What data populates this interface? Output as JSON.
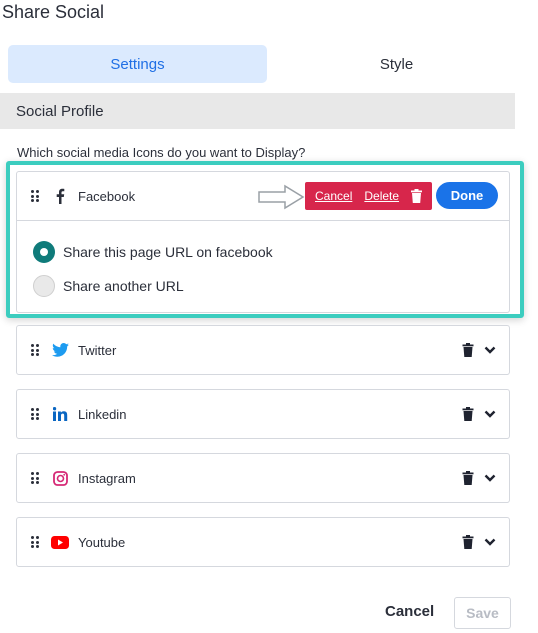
{
  "page": {
    "title": "Share Social"
  },
  "tabs": [
    {
      "label": "Settings",
      "active": true
    },
    {
      "label": "Style",
      "active": false
    }
  ],
  "section": {
    "header": "Social Profile",
    "question": "Which social media Icons do you want to Display?"
  },
  "editing": {
    "network": "Facebook",
    "cancel_label": "Cancel",
    "delete_label": "Delete",
    "done_label": "Done",
    "options": [
      {
        "label": "Share this page URL on facebook",
        "selected": true
      },
      {
        "label": "Share another URL",
        "selected": false
      }
    ]
  },
  "networks": [
    {
      "name": "Twitter",
      "icon": "twitter-icon",
      "color": "#1d9bf0"
    },
    {
      "name": "Linkedin",
      "icon": "linkedin-icon",
      "color": "#0a66c2"
    },
    {
      "name": "Instagram",
      "icon": "instagram-icon",
      "color": "#d62976"
    },
    {
      "name": "Youtube",
      "icon": "youtube-icon",
      "color": "#ff0000"
    }
  ],
  "footer": {
    "cancel_label": "Cancel",
    "save_label": "Save"
  },
  "colors": {
    "accent": "#1a73e8",
    "highlight": "#3ccdbf",
    "danger": "#d7264b",
    "radio": "#0f7b7a"
  }
}
